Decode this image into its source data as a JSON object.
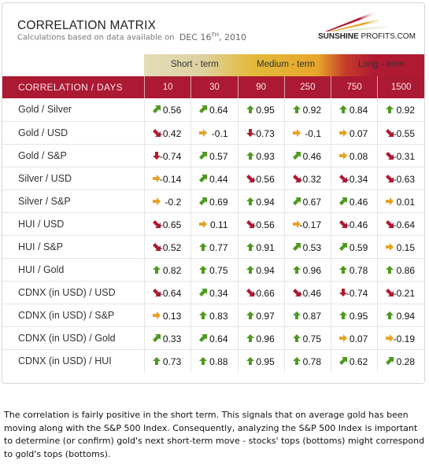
{
  "header": {
    "title": "CORRELATION MATRIX",
    "subtitle_prefix": "Calculations based on data available on",
    "date_main": "DEC 16",
    "date_sup": "TH",
    "date_year": ", 2010",
    "logo_bold": "SUNSHINE",
    "logo_rest": "PROFITS.COM"
  },
  "bands": {
    "short": "Short - term",
    "medium": "Medium - term",
    "long": "Long - term"
  },
  "table": {
    "corner_label": "CORRELATION / DAYS",
    "columns": [
      "10",
      "30",
      "90",
      "250",
      "750",
      "1500"
    ],
    "rows": [
      {
        "label": "Gold / Silver",
        "cells": [
          {
            "v": "0.56",
            "t": "up-right"
          },
          {
            "v": "0.64",
            "t": "up-right"
          },
          {
            "v": "0.95",
            "t": "up"
          },
          {
            "v": "0.92",
            "t": "up"
          },
          {
            "v": "0.84",
            "t": "up"
          },
          {
            "v": "0.92",
            "t": "up"
          }
        ]
      },
      {
        "label": "Gold / USD",
        "cells": [
          {
            "v": "-0.42",
            "t": "down-right"
          },
          {
            "v": "-0.1",
            "t": "right"
          },
          {
            "v": "-0.73",
            "t": "down"
          },
          {
            "v": "-0.1",
            "t": "right"
          },
          {
            "v": "0.07",
            "t": "right"
          },
          {
            "v": "-0.55",
            "t": "down-right"
          }
        ]
      },
      {
        "label": "Gold / S&P",
        "cells": [
          {
            "v": "-0.74",
            "t": "down"
          },
          {
            "v": "0.57",
            "t": "up-right"
          },
          {
            "v": "0.93",
            "t": "up"
          },
          {
            "v": "0.46",
            "t": "up-right"
          },
          {
            "v": "0.08",
            "t": "right"
          },
          {
            "v": "-0.31",
            "t": "down-right"
          }
        ]
      },
      {
        "label": "Silver / USD",
        "cells": [
          {
            "v": "-0.14",
            "t": "right"
          },
          {
            "v": "0.44",
            "t": "up-right"
          },
          {
            "v": "-0.56",
            "t": "down-right"
          },
          {
            "v": "-0.32",
            "t": "down-right"
          },
          {
            "v": "-0.34",
            "t": "down-right"
          },
          {
            "v": "-0.63",
            "t": "down-right"
          }
        ]
      },
      {
        "label": "Silver / S&P",
        "cells": [
          {
            "v": "-0.2",
            "t": "right"
          },
          {
            "v": "0.69",
            "t": "up-right"
          },
          {
            "v": "0.94",
            "t": "up"
          },
          {
            "v": "0.67",
            "t": "up-right"
          },
          {
            "v": "0.46",
            "t": "up-right"
          },
          {
            "v": "0.01",
            "t": "right"
          }
        ]
      },
      {
        "label": "HUI / USD",
        "cells": [
          {
            "v": "-0.65",
            "t": "down-right"
          },
          {
            "v": "0.11",
            "t": "right"
          },
          {
            "v": "-0.56",
            "t": "down-right"
          },
          {
            "v": "-0.17",
            "t": "right"
          },
          {
            "v": "-0.46",
            "t": "down-right"
          },
          {
            "v": "-0.64",
            "t": "down-right"
          }
        ]
      },
      {
        "label": "HUI / S&P",
        "cells": [
          {
            "v": "-0.52",
            "t": "down-right"
          },
          {
            "v": "0.77",
            "t": "up"
          },
          {
            "v": "0.91",
            "t": "up"
          },
          {
            "v": "0.53",
            "t": "up-right"
          },
          {
            "v": "0.59",
            "t": "up-right"
          },
          {
            "v": "0.15",
            "t": "right"
          }
        ]
      },
      {
        "label": "HUI / Gold",
        "cells": [
          {
            "v": "0.82",
            "t": "up"
          },
          {
            "v": "0.75",
            "t": "up"
          },
          {
            "v": "0.94",
            "t": "up"
          },
          {
            "v": "0.96",
            "t": "up"
          },
          {
            "v": "0.78",
            "t": "up"
          },
          {
            "v": "0.86",
            "t": "up"
          }
        ]
      },
      {
        "label": "CDNX (in USD) / USD",
        "cells": [
          {
            "v": "-0.64",
            "t": "down-right"
          },
          {
            "v": "0.34",
            "t": "up-right"
          },
          {
            "v": "-0.66",
            "t": "down-right"
          },
          {
            "v": "-0.46",
            "t": "down-right"
          },
          {
            "v": "-0.74",
            "t": "down"
          },
          {
            "v": "-0.21",
            "t": "down-right"
          }
        ]
      },
      {
        "label": "CDNX (in USD) / S&P",
        "cells": [
          {
            "v": "0.13",
            "t": "right"
          },
          {
            "v": "0.83",
            "t": "up"
          },
          {
            "v": "0.97",
            "t": "up"
          },
          {
            "v": "0.87",
            "t": "up"
          },
          {
            "v": "0.95",
            "t": "up"
          },
          {
            "v": "0.94",
            "t": "up"
          }
        ]
      },
      {
        "label": "CDNX (in USD) / Gold",
        "cells": [
          {
            "v": "0.33",
            "t": "up-right"
          },
          {
            "v": "0.64",
            "t": "up-right"
          },
          {
            "v": "0.96",
            "t": "up"
          },
          {
            "v": "0.75",
            "t": "up"
          },
          {
            "v": "0.07",
            "t": "right"
          },
          {
            "v": "-0.19",
            "t": "right"
          }
        ]
      },
      {
        "label": "CDNX (in USD) / HUI",
        "cells": [
          {
            "v": "0.73",
            "t": "up"
          },
          {
            "v": "0.88",
            "t": "up"
          },
          {
            "v": "0.95",
            "t": "up"
          },
          {
            "v": "0.78",
            "t": "up"
          },
          {
            "v": "0.62",
            "t": "up-right"
          },
          {
            "v": "0.28",
            "t": "up-right"
          }
        ]
      }
    ]
  },
  "arrow_colors": {
    "up": "#4d9a1f",
    "up-right": "#4d9a1f",
    "right": "#e8a324",
    "down-right": "#b01a33",
    "down": "#b01a33"
  },
  "note": "The correlation is fairly positive in the short term. This signals that on average gold has been moving along with the S&P 500 Index. Consequently, analyzing the S&P 500 Index is important to determine (or confirm) gold's next short-term move - stocks' tops (bottoms) might correspond to gold's tops (bottoms)."
}
